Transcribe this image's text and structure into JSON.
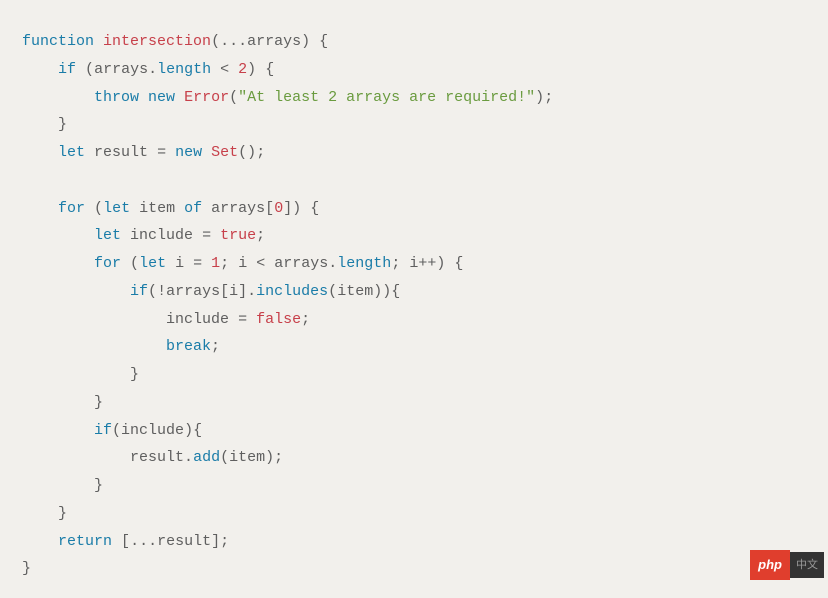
{
  "code": {
    "kw_function": "function",
    "fn_name": "intersection",
    "spread": "...",
    "param_arrays": "arrays",
    "kw_if": "if",
    "prop_length": "length",
    "op_lt": "<",
    "num_2": "2",
    "kw_throw": "throw",
    "kw_new": "new",
    "class_error": "Error",
    "str_err": "\"At least 2 arrays are required!\"",
    "kw_let": "let",
    "var_result": "result",
    "op_eq": "=",
    "class_set": "Set",
    "kw_for": "for",
    "var_item": "item",
    "kw_of": "of",
    "num_0": "0",
    "var_include": "include",
    "bool_true": "true",
    "var_i": "i",
    "num_1": "1",
    "op_semi": ";",
    "op_inc": "++",
    "op_not": "!",
    "method_includes": "includes",
    "bool_false": "false",
    "kw_break": "break",
    "method_add": "add",
    "kw_return": "return"
  },
  "watermark": {
    "php": "php",
    "cn": "中文"
  }
}
